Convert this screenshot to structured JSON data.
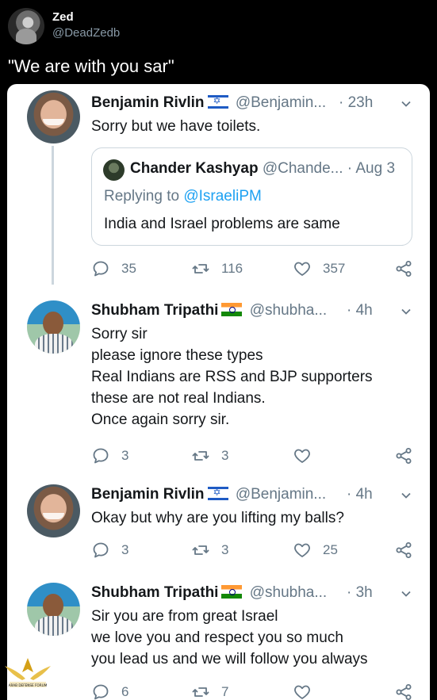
{
  "outer_tweet": {
    "name": "Zed",
    "handle": "@DeadZedb",
    "text": "\"We are with you sar\""
  },
  "thread": [
    {
      "name": "Benjamin Rivlin",
      "flag": "israel-flag",
      "handle": "@Benjamin...",
      "time": "· 23h",
      "text": "Sorry but we have toilets.",
      "quote": {
        "name": "Chander Kashyap",
        "handle": "@Chande...",
        "time": "· Aug 3",
        "replying_prefix": "Replying to ",
        "replying_to": "@IsraeliPM",
        "text": "India and Israel problems are same"
      },
      "stats": {
        "replies": "35",
        "retweets": "116",
        "likes": "357"
      }
    },
    {
      "name": "Shubham Tripathi",
      "flag": "india-flag",
      "handle": "@shubha...",
      "time": "· 4h",
      "text": "Sorry sir\nplease ignore these types\nReal Indians are RSS and BJP supporters\nthese are not real Indians.\nOnce again sorry sir.",
      "stats": {
        "replies": "3",
        "retweets": "3",
        "likes": ""
      }
    },
    {
      "name": "Benjamin Rivlin",
      "flag": "israel-flag",
      "handle": "@Benjamin...",
      "time": "· 4h",
      "text": "Okay but why are you lifting my balls?",
      "stats": {
        "replies": "3",
        "retweets": "3",
        "likes": "25"
      }
    },
    {
      "name": "Shubham Tripathi",
      "flag": "india-flag",
      "handle": "@shubha...",
      "time": "· 3h",
      "text": "Sir you are from great Israel\nwe love you and respect you so much\nyou lead us and we will follow you always",
      "stats": {
        "replies": "6",
        "retweets": "7",
        "likes": ""
      }
    }
  ],
  "watermark": {
    "text": "ARAB DEFENSE FORUM"
  },
  "colors": {
    "background": "#000000",
    "card": "#ffffff",
    "secondary_text": "#657786",
    "link": "#1da1f2",
    "border": "#ccd6dd"
  }
}
